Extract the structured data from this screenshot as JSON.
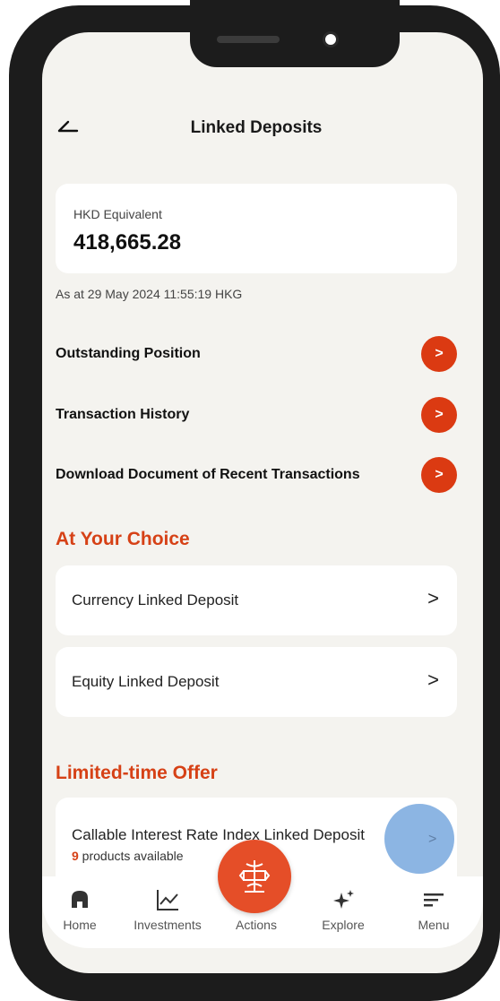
{
  "header": {
    "title": "Linked Deposits"
  },
  "balance": {
    "label": "HKD Equivalent",
    "value": "418,665.28"
  },
  "as_at": "As at 29 May 2024 11:55:19 HKG",
  "links": [
    {
      "label": "Outstanding Position",
      "icon": ">"
    },
    {
      "label": "Transaction History",
      "icon": ">"
    },
    {
      "label": "Download Document of Recent Transactions",
      "icon": ">"
    }
  ],
  "choice": {
    "heading": "At Your Choice",
    "items": [
      {
        "label": "Currency Linked Deposit",
        "chevron": ">"
      },
      {
        "label": "Equity Linked Deposit",
        "chevron": ">"
      }
    ]
  },
  "offer": {
    "heading": "Limited-time Offer",
    "item": {
      "label": "Callable Interest Rate Index Linked Deposit",
      "count": "9",
      "count_suffix": " products available",
      "chevron": ">"
    }
  },
  "tabs": [
    {
      "label": "Home",
      "icon": "home-icon"
    },
    {
      "label": "Investments",
      "icon": "chart-line-icon"
    },
    {
      "label": "Actions",
      "icon": "actions-globe-icon"
    },
    {
      "label": "Explore",
      "icon": "sparkle-icon"
    },
    {
      "label": "Menu",
      "icon": "menu-lines-icon"
    }
  ],
  "colors": {
    "accent": "#d64116",
    "button": "#db3a12",
    "background": "#f4f3ef",
    "tap_indicator": "#78a8de"
  }
}
